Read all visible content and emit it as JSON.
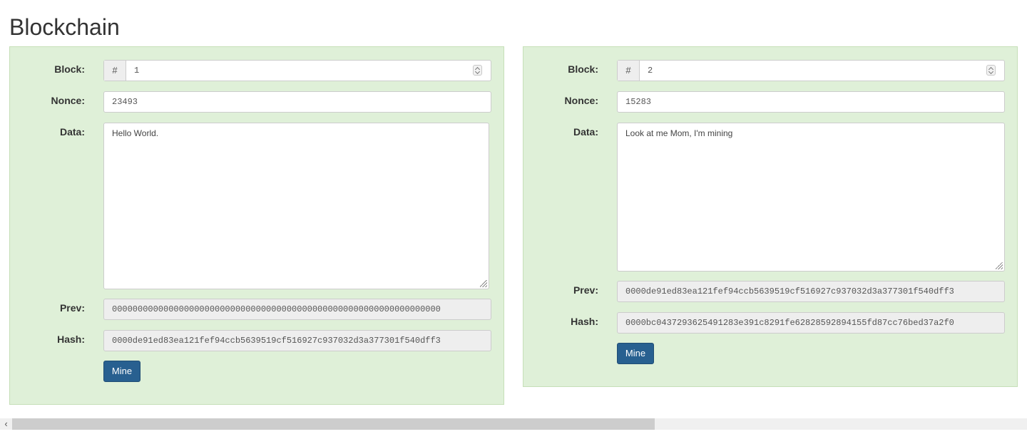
{
  "page": {
    "title": "Blockchain"
  },
  "labels": {
    "block": "Block:",
    "nonce": "Nonce:",
    "data": "Data:",
    "prev": "Prev:",
    "hash": "Hash:",
    "block_prefix": "#"
  },
  "blocks": [
    {
      "number": "1",
      "nonce": "23493",
      "data": "Hello World.",
      "prev": "0000000000000000000000000000000000000000000000000000000000000000",
      "hash": "0000de91ed83ea121fef94ccb5639519cf516927c937032d3a377301f540dff3",
      "mine_label": "Mine"
    },
    {
      "number": "2",
      "nonce": "15283",
      "data": "Look at me Mom, I'm mining",
      "prev": "0000de91ed83ea121fef94ccb5639519cf516927c937032d3a377301f540dff3",
      "hash": "0000bc0437293625491283e391c8291fe62828592894155fd87cc76bed37a2f0",
      "mine_label": "Mine"
    }
  ],
  "scrollbar": {
    "left_arrow": "‹"
  }
}
